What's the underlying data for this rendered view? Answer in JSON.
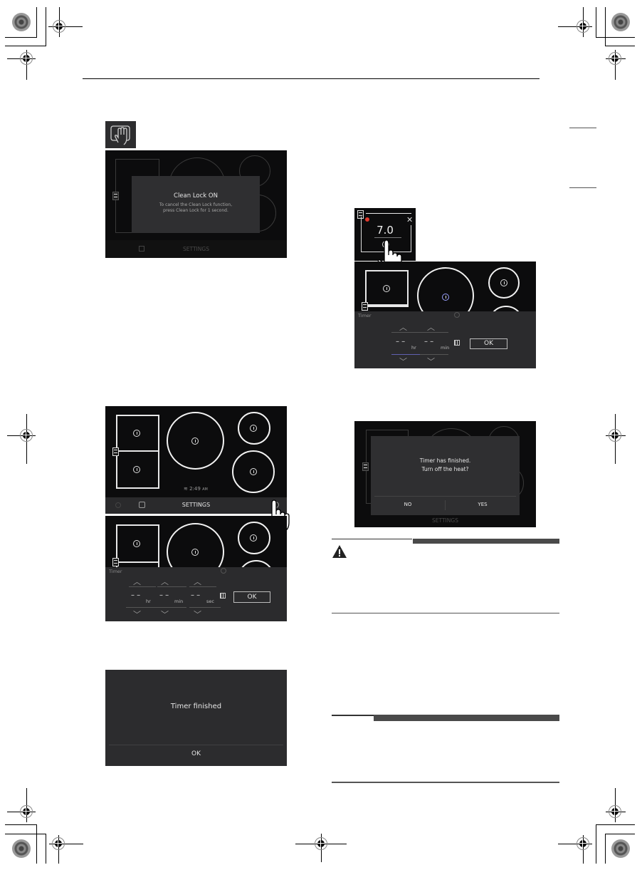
{
  "page": {
    "icon_clean_lock": "clean-lock-hand-icon"
  },
  "clean_lock_screen": {
    "title": "Clean Lock ON",
    "message_line1": "To cancel the Clean Lock function,",
    "message_line2": "press Clean Lock for 1 second.",
    "bottom_bar_label": "SETTINGS"
  },
  "cooktop_home_screen": {
    "clock": "2:49",
    "clock_suffix": "AM",
    "bottom_bar_label": "SETTINGS"
  },
  "timer_screen_left": {
    "title": "Timer",
    "hours": "– –",
    "minutes": "– –",
    "seconds": "– –",
    "hr_unit": "hr",
    "min_unit": "min",
    "sec_unit": "sec",
    "ok_label": "OK"
  },
  "timer_finished_dialog": {
    "message": "Timer finished",
    "ok_label": "OK"
  },
  "zone_popup": {
    "power_level": "7.0"
  },
  "timer_screen_right": {
    "title": "Timer",
    "hours": "– –",
    "minutes": "– –",
    "hr_unit": "hr",
    "min_unit": "min",
    "ok_label": "OK"
  },
  "turn_off_dialog": {
    "line1": "Timer has finished.",
    "line2": "Turn off the heat?",
    "no_label": "NO",
    "yes_label": "YES",
    "bottom_bar_label": "SETTINGS"
  },
  "warning_box": {
    "icon": "warning-triangle-icon"
  },
  "note_box": {}
}
